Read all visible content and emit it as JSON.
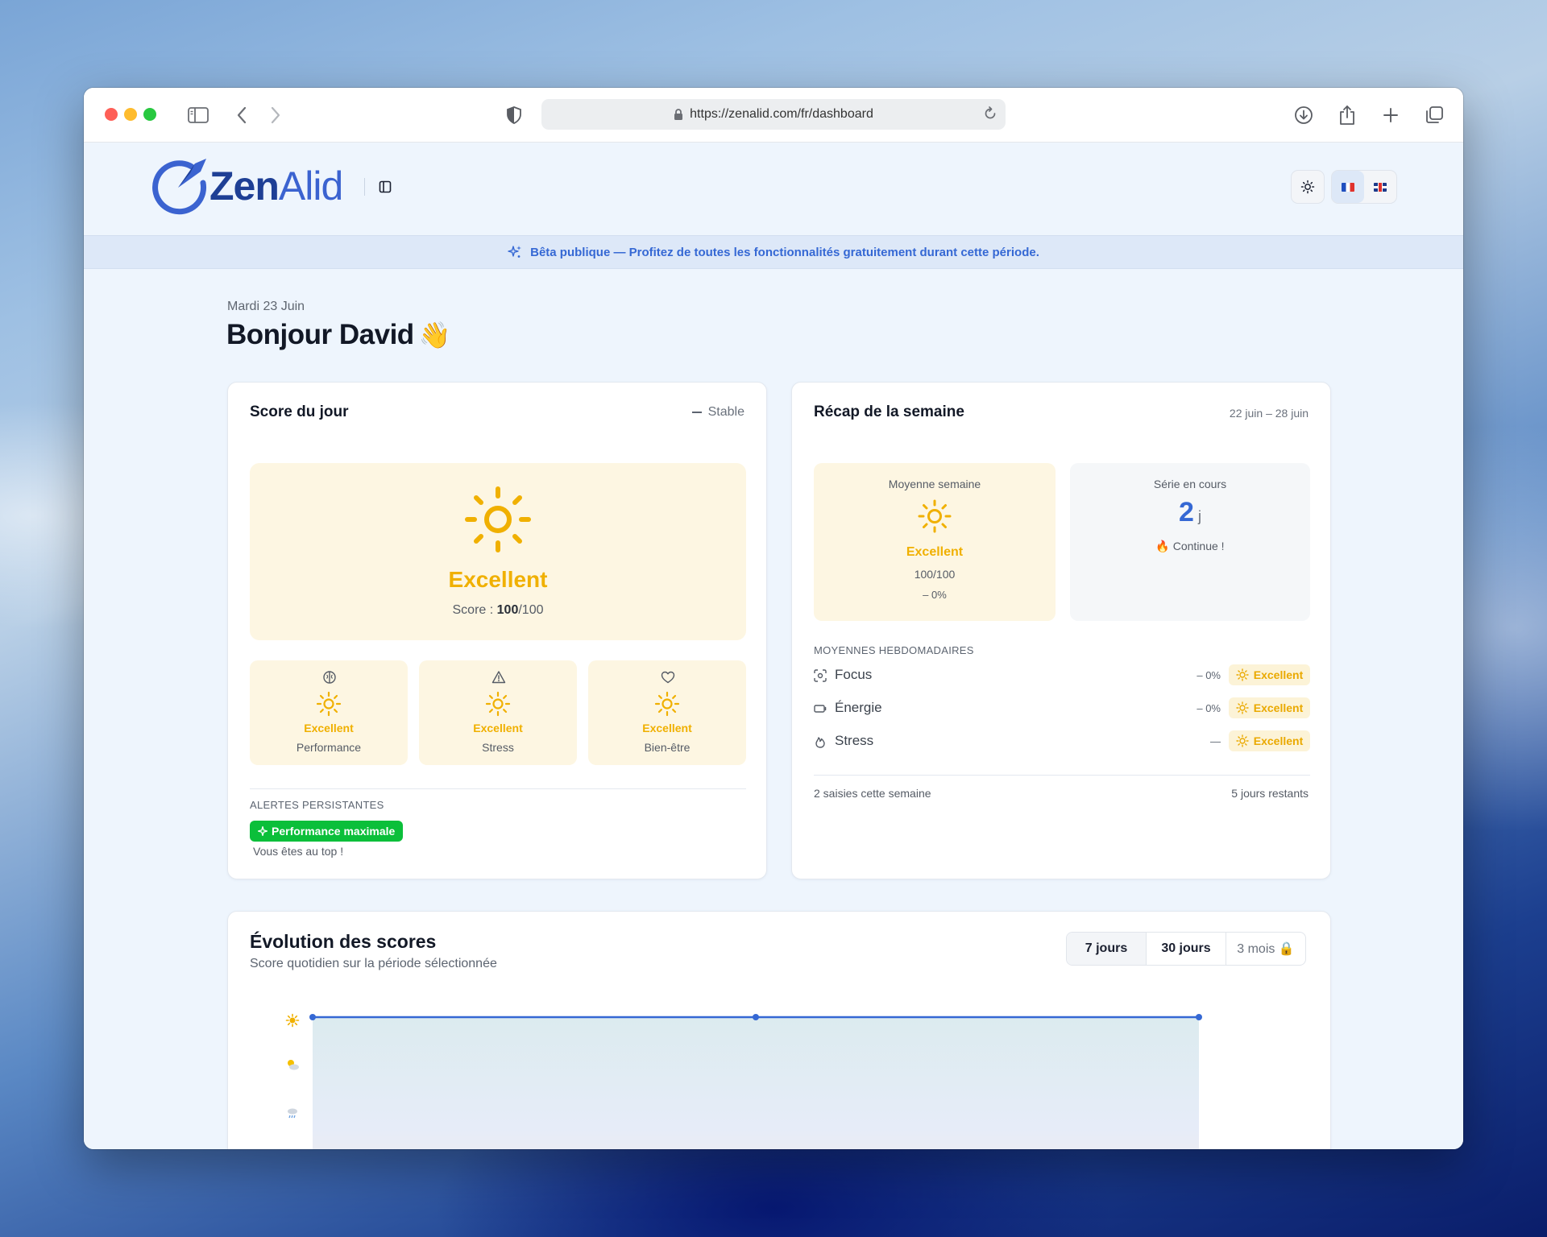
{
  "browser": {
    "url": "https://zenalid.com/fr/dashboard"
  },
  "header": {
    "logo_text_bold": "Zen",
    "logo_text_light": "Alid",
    "lang_fr": "FR",
    "lang_en": "EN"
  },
  "banner": {
    "text": "Bêta publique — Profitez de toutes les fonctionnalités gratuitement durant cette période."
  },
  "greeting": {
    "date": "Mardi 23 Juin",
    "title": "Bonjour David",
    "emoji": "👋"
  },
  "score_card": {
    "title": "Score du jour",
    "trend": "Stable",
    "level": "Excellent",
    "score_prefix": "Score : ",
    "score_value": "100",
    "score_max": "/100",
    "sub_scores": [
      {
        "icon": "brain-icon",
        "level": "Excellent",
        "name": "Performance"
      },
      {
        "icon": "warning-icon",
        "level": "Excellent",
        "name": "Stress"
      },
      {
        "icon": "heart-icon",
        "level": "Excellent",
        "name": "Bien-être"
      }
    ],
    "alerts_label": "ALERTES PERSISTANTES",
    "alert_pill": "Performance maximale",
    "alert_text": "Vous êtes au top !"
  },
  "week_card": {
    "title": "Récap de la semaine",
    "range": "22 juin – 28 juin",
    "avg_label": "Moyenne semaine",
    "avg_level": "Excellent",
    "avg_score": "100/100",
    "avg_delta": "– 0%",
    "streak_label": "Série en cours",
    "streak_value": "2",
    "streak_unit": "j",
    "streak_text": "🔥 Continue !",
    "weekly_label": "MOYENNES HEBDOMADAIRES",
    "rows": [
      {
        "icon": "focus-icon",
        "name": "Focus",
        "delta": "– 0%",
        "badge": "Excellent"
      },
      {
        "icon": "battery-icon",
        "name": "Énergie",
        "delta": "– 0%",
        "badge": "Excellent"
      },
      {
        "icon": "flame-icon",
        "name": "Stress",
        "delta": "—",
        "badge": "Excellent"
      }
    ],
    "entries": "2 saisies cette semaine",
    "remaining": "5 jours restants"
  },
  "evolution": {
    "title": "Évolution des scores",
    "subtitle": "Score quotidien sur la période sélectionnée",
    "ranges": [
      {
        "label": "7 jours",
        "active": true
      },
      {
        "label": "30 jours",
        "active": false
      },
      {
        "label": "3 mois 🔒",
        "active": false
      }
    ]
  },
  "chart_data": {
    "type": "area",
    "levels": [
      "sun",
      "sun-cloud",
      "rain"
    ],
    "x": [
      1,
      2,
      3
    ],
    "values": [
      100,
      100,
      100
    ],
    "ylim": [
      0,
      100
    ],
    "line_color": "#3568d4",
    "grid": false
  },
  "colors": {
    "accent": "#3568d4",
    "sun": "#f0b000",
    "success": "#0bbf3a",
    "page_bg": "#eef5fd"
  }
}
